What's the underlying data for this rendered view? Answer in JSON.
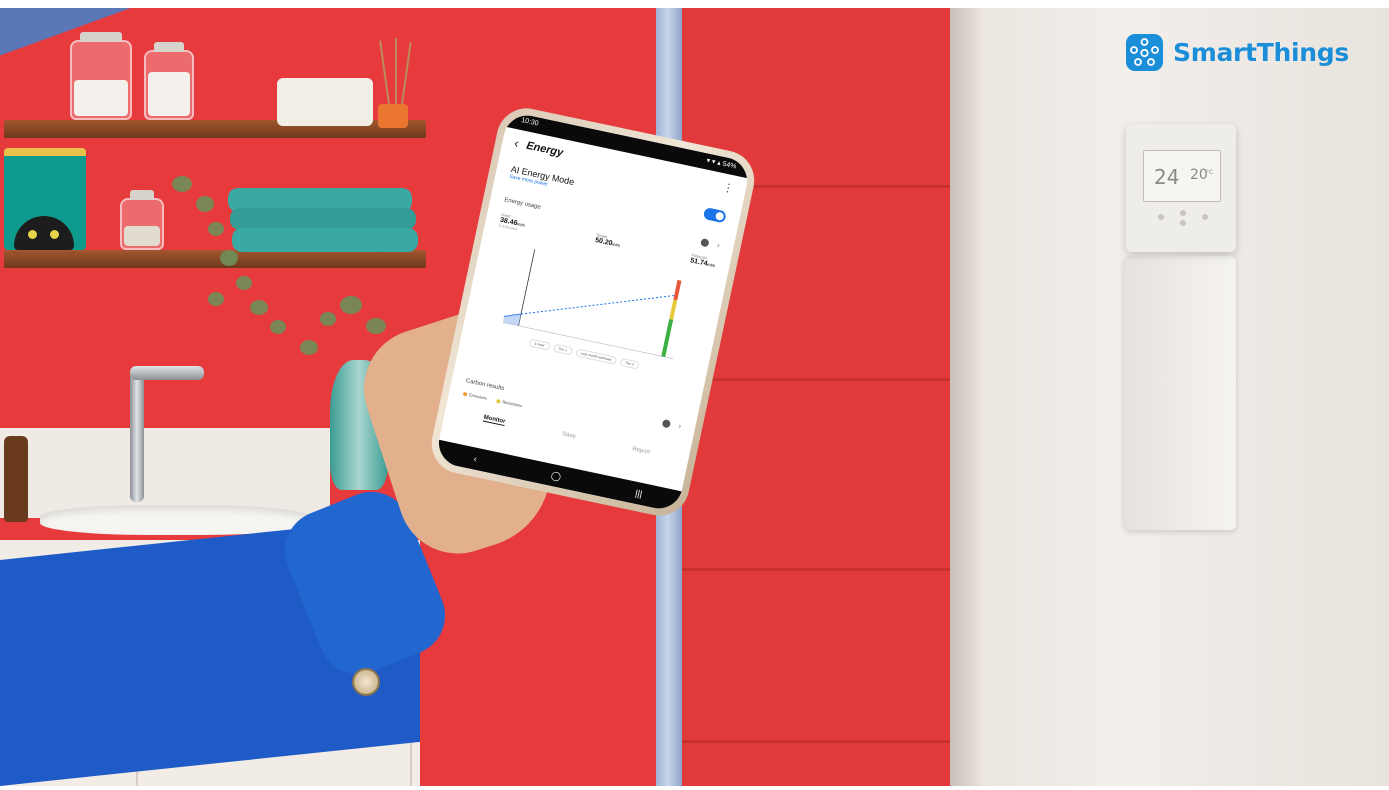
{
  "brand": {
    "name": "SmartThings",
    "color": "#1b8ed9"
  },
  "phone": {
    "status_time": "10:30",
    "status_icons": "▾ ▾ ▴ 54%",
    "screen_title": "Energy",
    "back_icon": "‹",
    "menu_icon": "⋮",
    "ai_mode": {
      "label": "AI Energy Mode",
      "sub": "Save more power",
      "enabled": true
    },
    "energy_usage": {
      "title": "Energy usage",
      "stats": [
        {
          "label": "Used",
          "value": "38.46",
          "unit": "kWh",
          "sub": "€ 9.32 used"
        },
        {
          "label": "Target",
          "value": "50.20",
          "unit": "kWh",
          "sub": ""
        },
        {
          "label": "Forecast",
          "value": "51.74",
          "unit": "kWh",
          "sub": ""
        }
      ],
      "chips": [
        "1 Hour",
        "Tier 1",
        "Last month estimate",
        "Tier 3"
      ]
    },
    "carbon": {
      "title": "Carbon results",
      "legend": [
        {
          "label": "Emissions",
          "color": "#f29b38"
        },
        {
          "label": "Reductions",
          "color": "#e5c93b"
        }
      ]
    },
    "tabs": [
      "Monitor",
      "Save",
      "Report"
    ],
    "nav_icons": [
      "‹",
      "◯",
      "|||"
    ]
  },
  "thermostat": {
    "temp_current": "24",
    "temp_target": "20",
    "unit": "°C"
  }
}
